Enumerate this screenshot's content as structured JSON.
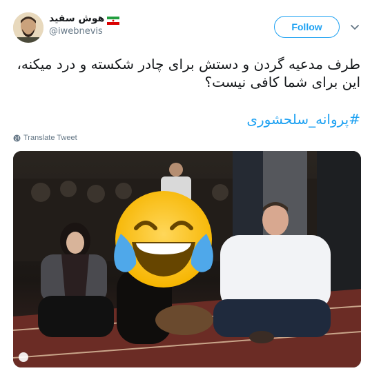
{
  "header": {
    "display_name": "هوش سفید",
    "handle": "@iwebnevis",
    "follow_label": "Follow"
  },
  "tweet": {
    "line1": "طرف مدعیه گردن و دستش برای چادر شکسته و درد میکنه،",
    "line2": "این برای شما کافی نیست؟",
    "hashtag": "#پروانه_سلحشوری",
    "translate_label": "Translate Tweet"
  },
  "icons": {
    "flag": "iran-flag-icon",
    "menu": "chevron-down-icon",
    "translate": "globe-icon",
    "overlay": "face-with-tears-of-joy-emoji"
  },
  "colors": {
    "accent": "#1da1f2",
    "text": "#14171a",
    "muted": "#657786"
  }
}
